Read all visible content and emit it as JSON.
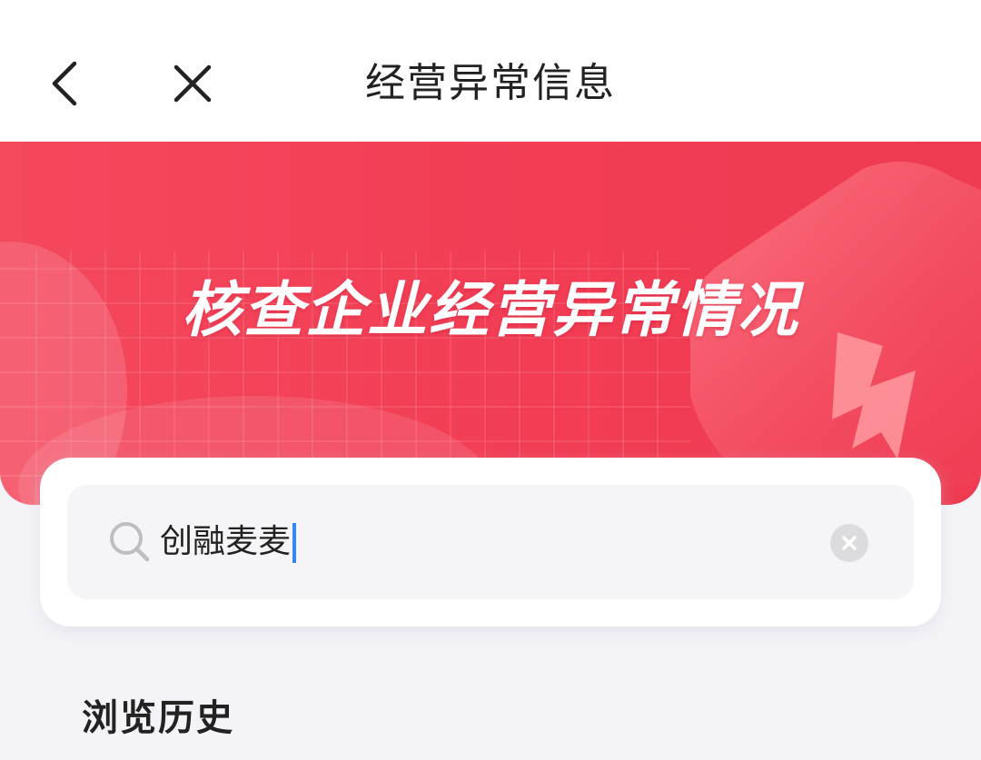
{
  "header": {
    "title": "经营异常信息",
    "back_icon": "chevron-left-icon",
    "close_icon": "close-icon"
  },
  "banner": {
    "headline": "核查企业经营异常情况",
    "background_color": "#f2405a",
    "decoration_icon": "lightning-bolt-icon"
  },
  "search": {
    "icon": "search-icon",
    "value": "创融麦麦",
    "clear_icon": "clear-icon",
    "caret_color": "#3a86f0"
  },
  "history": {
    "title": "浏览历史"
  }
}
